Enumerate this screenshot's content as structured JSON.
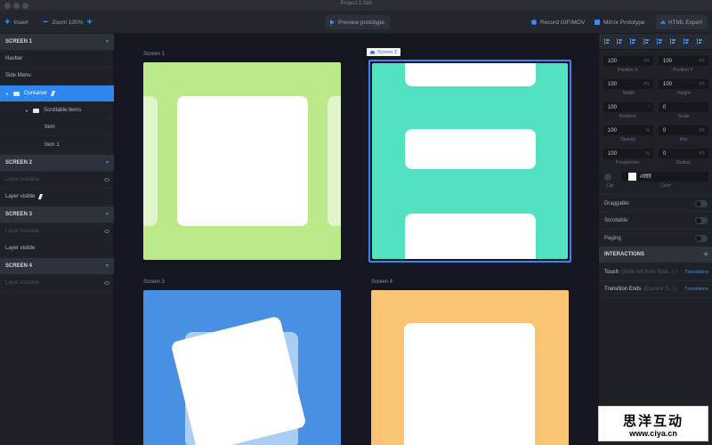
{
  "window": {
    "title": "Project-1.fold"
  },
  "toolbar": {
    "insert_label": "Insert",
    "zoom_label": "Zoom 100%",
    "preview_label": "Preview prototype",
    "record_label": "Record GIF/MOV",
    "mirror_label": "Mirror Prototype",
    "export_label": "HTML Export"
  },
  "layers": {
    "screen1": {
      "title": "SCREEN 1",
      "items": [
        "Navbar",
        "Side Menu",
        "Container",
        "Scrollable items",
        "Item",
        "Item 1"
      ]
    },
    "screen2": {
      "title": "SCREEN 2",
      "items": [
        "Layer invisible",
        "Layer visible"
      ]
    },
    "screen3": {
      "title": "SCREEN 3",
      "items": [
        "Layer invisible",
        "Layer visible"
      ]
    },
    "screen4": {
      "title": "SCREEN 4",
      "items": [
        "Layer invisible"
      ]
    }
  },
  "canvas": {
    "screen1_label": "Screen 1",
    "screen2_label": "Screen 2",
    "screen3_label": "Screen 3",
    "screen4_label": "Screen 4",
    "colors": {
      "screen1": "#bce98a",
      "screen2": "#52e2c2",
      "screen3": "#4a90e2",
      "screen4": "#f9c573",
      "selection": "#3b82f6"
    }
  },
  "properties": {
    "position_x": {
      "value": "100",
      "unit": "PX",
      "label": "Position X"
    },
    "position_y": {
      "value": "100",
      "unit": "PX",
      "label": "Position Y"
    },
    "width": {
      "value": "100",
      "unit": "PX",
      "label": "Width"
    },
    "height": {
      "value": "100",
      "unit": "PX",
      "label": "Height"
    },
    "rotation": {
      "value": "100",
      "unit": "°",
      "label": "Rotation"
    },
    "scale": {
      "value": "0",
      "unit": "",
      "label": "Scale"
    },
    "opacity": {
      "value": "100",
      "unit": "%",
      "label": "Opacity"
    },
    "blur": {
      "value": "0",
      "unit": "PX",
      "label": "Blur"
    },
    "perspective": {
      "value": "100",
      "unit": "%",
      "label": "Perspective"
    },
    "radius": {
      "value": "0",
      "unit": "PX",
      "label": "Radius"
    },
    "clip_label": "Clip",
    "color_label": "Color",
    "color_value": "#ffffff",
    "draggable_label": "Draggable",
    "scrollable_label": "Scrollable",
    "paging_label": "Paging"
  },
  "interactions": {
    "header": "INTERACTIONS",
    "rows": [
      {
        "name": "Touch",
        "detail": "(Slide left from Scre...)",
        "action": "Transitions"
      },
      {
        "name": "Transition Ends",
        "detail": "(Current S...)",
        "action": "Transitions"
      }
    ]
  },
  "watermark": {
    "cn": "思洋互动",
    "url": "www.ciya.cn"
  }
}
